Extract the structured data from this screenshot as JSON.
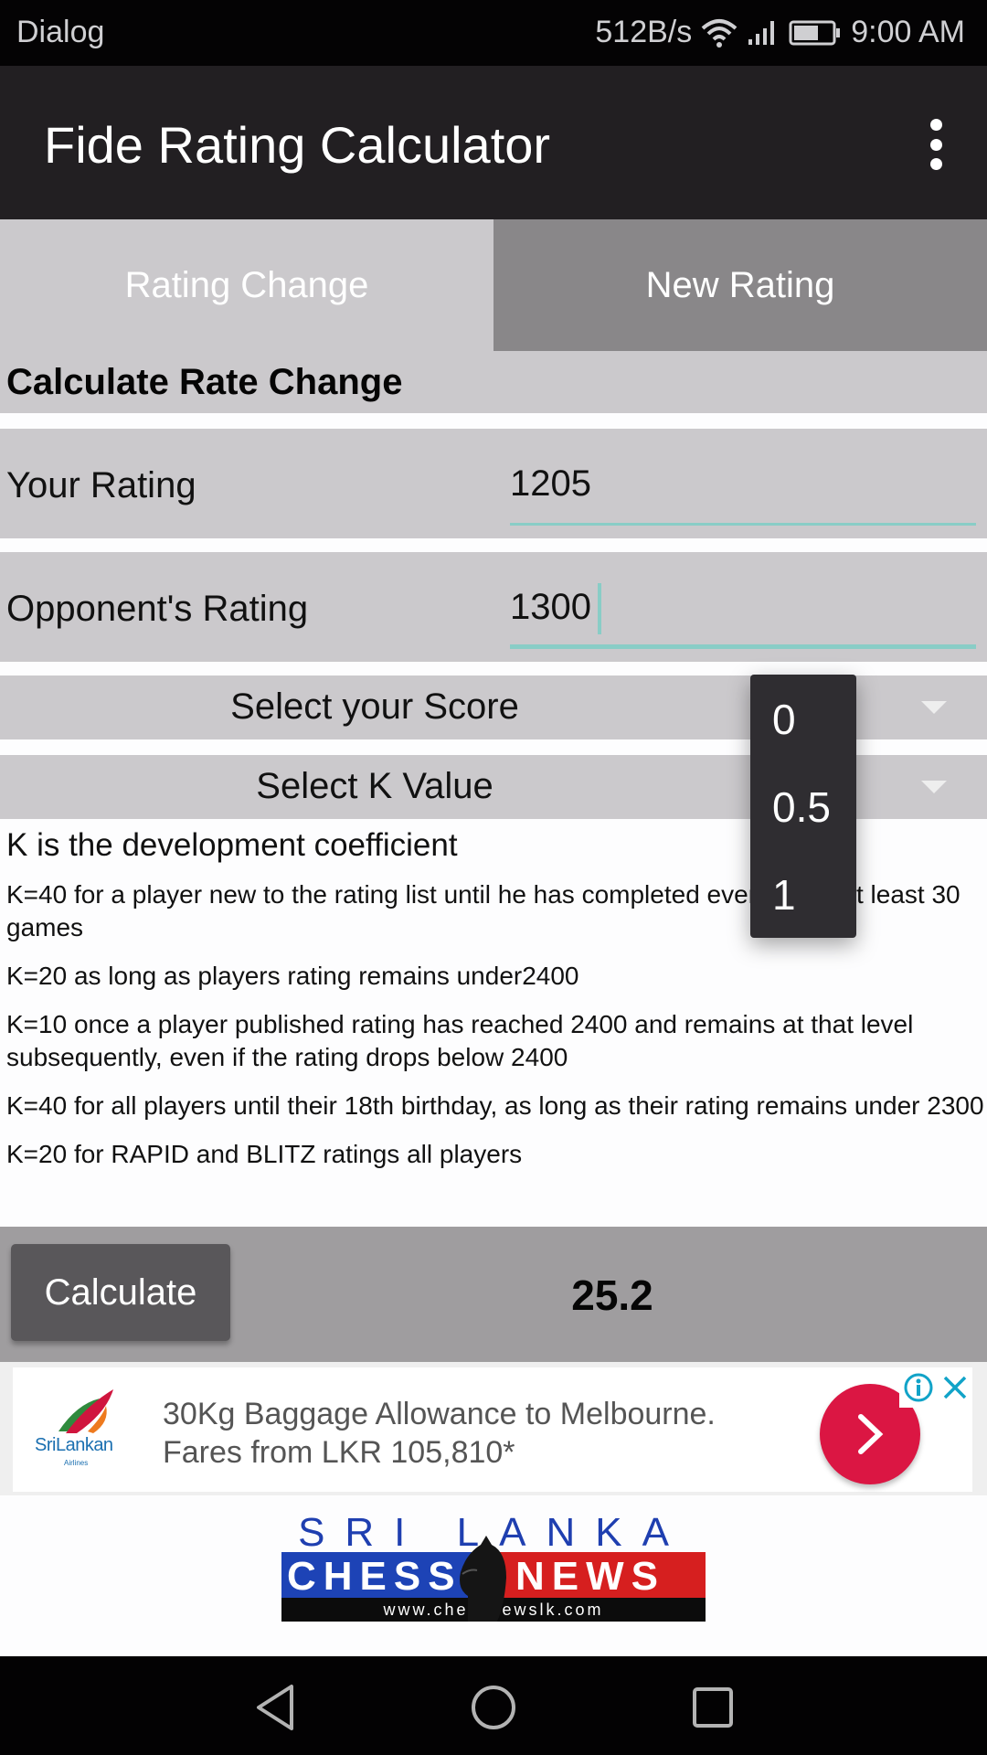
{
  "status_bar": {
    "left_label": "Dialog",
    "network_speed": "512B/s",
    "time": "9:00 AM",
    "icons": [
      "wifi-icon",
      "signal-icon",
      "battery-icon"
    ]
  },
  "app_bar": {
    "title": "Fide Rating Calculator",
    "overflow_icon": "more-vert-icon"
  },
  "tabs": [
    {
      "label": "Rating Change",
      "selected": false
    },
    {
      "label": "New Rating",
      "selected": true
    }
  ],
  "form": {
    "heading": "Calculate Rate Change",
    "your_rating": {
      "label": "Your Rating",
      "value": "1205"
    },
    "opponent_rating": {
      "label": "Opponent's Rating",
      "value": "1300"
    },
    "score_spinner": {
      "label": "Select your Score"
    },
    "k_spinner": {
      "label": "Select K Value"
    }
  },
  "score_dropdown": {
    "options": [
      "0",
      "0.5",
      "1"
    ]
  },
  "k_info": {
    "title": "K is the development coefficient",
    "lines": [
      "K=40 for a player new to the rating list until he has completed events with at least 30 games",
      "K=20 as long as players rating remains under2400",
      "K=10 once a player published rating has reached 2400 and remains at that level subsequently, even if the rating drops below 2400",
      "K=40 for all players until their 18th birthday, as long as their rating remains under 2300",
      "K=20 for RAPID and BLITZ ratings all players"
    ]
  },
  "calculate": {
    "button_label": "Calculate",
    "result": "25.2"
  },
  "ad": {
    "brand": "SriLankan",
    "brand_sub": "Airlines",
    "line1": "30Kg Baggage Allowance to Melbourne.",
    "line2": "Fares from LKR 105,810*",
    "cta_color": "#db1643",
    "accent_color": "#11a3c8"
  },
  "footer_logo": {
    "top": "SRI LANKA",
    "left": "CHESS",
    "right": "NEWS",
    "url": "www.chessnewslk.com"
  },
  "colors": {
    "app_bar": "#221f22",
    "tab_inactive": "#cbc9cc",
    "tab_active": "#898789",
    "input_underline": "#89cdc6",
    "calc_row": "#9f9d9f",
    "calc_button": "#59575a"
  }
}
